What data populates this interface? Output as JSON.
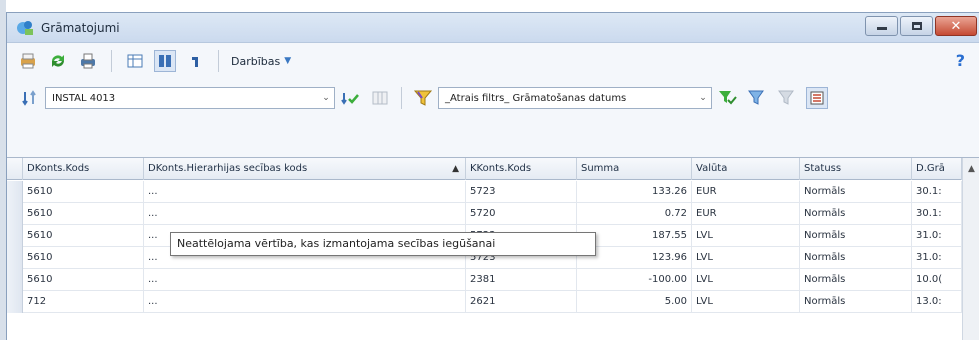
{
  "window": {
    "title": "Grāmatojumi"
  },
  "toolbar": {
    "actions_label": "Darbības",
    "help_label": "?"
  },
  "filters": {
    "account_value": "INSTAL 4013",
    "quick_filter_value": "_Ātrais filtrs_ Grāmatošanas datums"
  },
  "table": {
    "columns": [
      {
        "label": "DKonts.Kods"
      },
      {
        "label": "DKonts.Hierarhijas secības kods",
        "sorted": true
      },
      {
        "label": "KKonts.Kods"
      },
      {
        "label": "Summa"
      },
      {
        "label": "Valūta"
      },
      {
        "label": "Statuss"
      },
      {
        "label": "D.Grā"
      }
    ],
    "rows": [
      [
        "5610",
        "...",
        "5723",
        "133.26",
        "EUR",
        "Normāls",
        "30.1:"
      ],
      [
        "5610",
        "...",
        "5720",
        "0.72",
        "EUR",
        "Normāls",
        "30.1:"
      ],
      [
        "5610",
        "...",
        "5723",
        "187.55",
        "LVL",
        "Normāls",
        "31.0:"
      ],
      [
        "5610",
        "...",
        "5723",
        "123.96",
        "LVL",
        "Normāls",
        "31.0:"
      ],
      [
        "5610",
        "...",
        "2381",
        "-100.00",
        "LVL",
        "Normāls",
        "10.0("
      ],
      [
        "712",
        "...",
        "2621",
        "5.00",
        "LVL",
        "Normāls",
        "13.0:"
      ]
    ]
  },
  "tooltip": {
    "text": "Neattēlojama vērtība, kas izmantojama secības iegūšanai"
  },
  "colors": {
    "accent": "#2a6fd1",
    "close_button": "#c54a33",
    "header_bg": "#e5ebf3"
  }
}
